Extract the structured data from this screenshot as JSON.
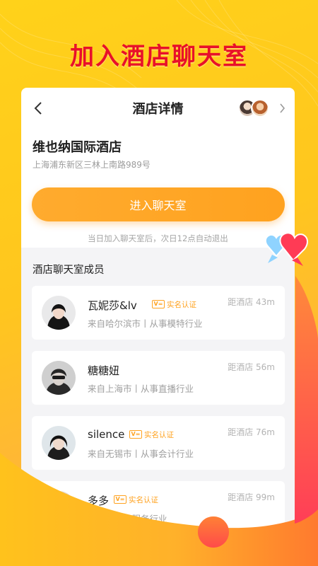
{
  "promo": {
    "title": "加入酒店聊天室"
  },
  "nav": {
    "title": "酒店详情",
    "back_icon": "chevron-left-icon",
    "more_icon": "chevron-right-icon"
  },
  "hotel": {
    "name": "维也纳国际酒店",
    "address": "上海浦东新区三林上南路989号"
  },
  "enter": {
    "button_label": "进入聊天室",
    "note": "当日加入聊天室后，次日12点自动退出"
  },
  "members": {
    "title": "酒店聊天室成员",
    "verified_badge": "实名认证",
    "verified_mark": "V=",
    "list": [
      {
        "name": "瓦妮莎&lv",
        "verified": true,
        "origin": "来自哈尔滨市丨从事模特行业",
        "distance": "距酒店 43m"
      },
      {
        "name": "糖糖妞",
        "verified": false,
        "origin": "来自上海市丨从事直播行业",
        "distance": "距酒店 56m"
      },
      {
        "name": "silence",
        "verified": true,
        "origin": "来自无锡市丨从事会计行业",
        "distance": "距酒店 76m"
      },
      {
        "name": "多多",
        "verified": true,
        "origin": "来自丨从事服务行业",
        "distance": "距酒店 99m"
      }
    ]
  },
  "colors": {
    "brand_red": "#e8102a",
    "accent_orange": "#ffa21f",
    "background_yellow": "#ffc61e"
  }
}
